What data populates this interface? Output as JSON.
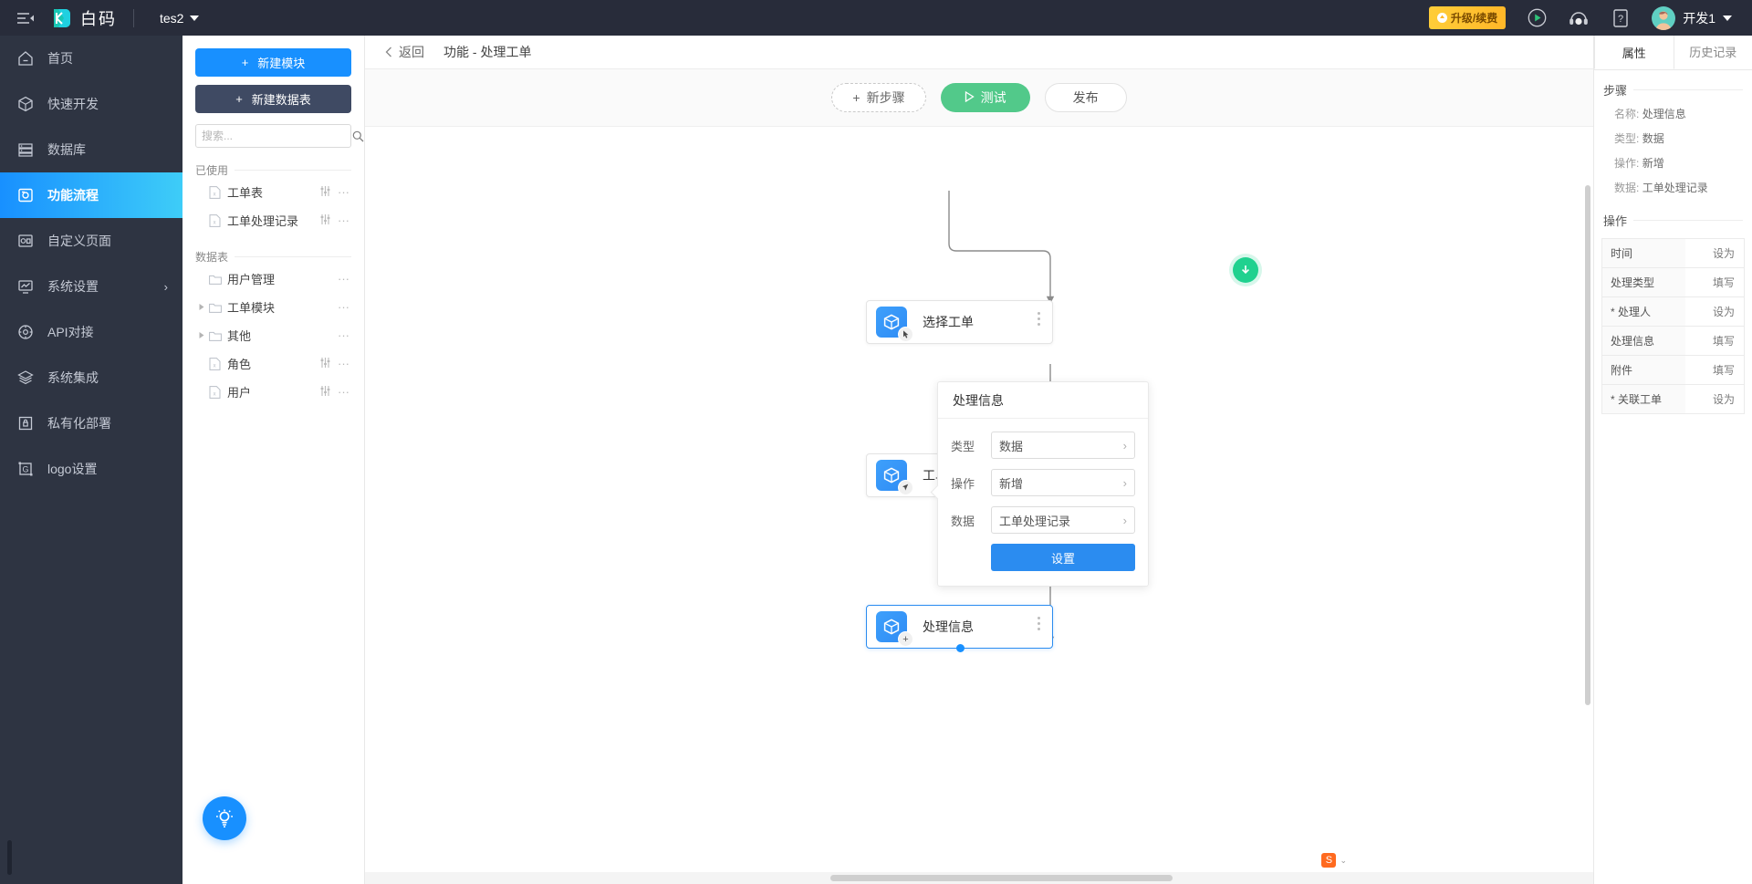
{
  "topbar": {
    "hamburger_icon": "menu-collapse-icon",
    "logo_text": "白码",
    "project_name": "tes2",
    "upgrade_label": "升级/续费",
    "icons": [
      "play-circle-icon",
      "headset-support-icon",
      "help-question-icon"
    ],
    "user_name": "开发1"
  },
  "leftnav": {
    "items": [
      {
        "label": "首页",
        "icon": "home-icon",
        "active": false,
        "arrow": ""
      },
      {
        "label": "快速开发",
        "icon": "cube-icon",
        "active": false,
        "arrow": ""
      },
      {
        "label": "数据库",
        "icon": "database-icon",
        "active": false,
        "arrow": ""
      },
      {
        "label": "功能流程",
        "icon": "flow-icon",
        "active": true,
        "arrow": ""
      },
      {
        "label": "自定义页面",
        "icon": "dashboard-icon",
        "active": false,
        "arrow": ""
      },
      {
        "label": "系统设置",
        "icon": "monitor-chart-icon",
        "active": false,
        "arrow": "›"
      },
      {
        "label": "API对接",
        "icon": "api-icon",
        "active": false,
        "arrow": ""
      },
      {
        "label": "系统集成",
        "icon": "layers-icon",
        "active": false,
        "arrow": ""
      },
      {
        "label": "私有化部署",
        "icon": "lock-server-icon",
        "active": false,
        "arrow": ""
      },
      {
        "label": "logo设置",
        "icon": "logo-frame-icon",
        "active": false,
        "arrow": ""
      }
    ]
  },
  "modpanel": {
    "new_module_label": "新建模块",
    "new_table_label": "新建数据表",
    "search_placeholder": "搜索...",
    "search_value": "",
    "group_used": "已使用",
    "group_tables": "数据表",
    "used_items": [
      {
        "label": "工单表",
        "icon": "file-sheet-icon",
        "has_twisty": false,
        "has_settings": true
      },
      {
        "label": "工单处理记录",
        "icon": "file-sheet-icon",
        "has_twisty": false,
        "has_settings": true
      }
    ],
    "table_items": [
      {
        "label": "用户管理",
        "icon": "folder-icon",
        "has_twisty": false,
        "has_settings": false
      },
      {
        "label": "工单模块",
        "icon": "folder-icon",
        "has_twisty": true,
        "has_settings": false
      },
      {
        "label": "其他",
        "icon": "folder-icon",
        "has_twisty": true,
        "has_settings": false
      },
      {
        "label": "角色",
        "icon": "file-sheet-icon",
        "has_twisty": false,
        "has_settings": true
      },
      {
        "label": "用户",
        "icon": "file-sheet-icon",
        "has_twisty": false,
        "has_settings": true
      }
    ]
  },
  "breadcrumb": {
    "back_label": "返回",
    "title": "功能 - 处理工单"
  },
  "flowtoolbar": {
    "new_step_label": "新步骤",
    "test_label": "测试",
    "publish_label": "发布"
  },
  "flow": {
    "nodes": [
      {
        "label": "选择工单",
        "badge": "cursor-pointer-icon",
        "selected": false
      },
      {
        "label": "工单信息",
        "badge": "cursor-arrow-icon",
        "selected": false
      },
      {
        "label": "处理信息",
        "badge": "plus-icon",
        "selected": true
      }
    ]
  },
  "popup": {
    "title": "处理信息",
    "rows": [
      {
        "label": "类型",
        "value": "数据"
      },
      {
        "label": "操作",
        "value": "新增"
      },
      {
        "label": "数据",
        "value": "工单处理记录"
      }
    ],
    "button_label": "设置"
  },
  "rightpanel": {
    "tabs": [
      {
        "label": "属性",
        "active": true
      },
      {
        "label": "历史记录",
        "active": false
      }
    ],
    "section_step": "步骤",
    "step_fields": [
      {
        "key": "名称:",
        "value": "处理信息"
      },
      {
        "key": "类型:",
        "value": "数据"
      },
      {
        "key": "操作:",
        "value": "新增"
      },
      {
        "key": "数据:",
        "value": "工单处理记录"
      }
    ],
    "section_ops": "操作",
    "op_rows": [
      {
        "name": "时间",
        "action": "设为"
      },
      {
        "name": "处理类型",
        "action": "填写"
      },
      {
        "name": "* 处理人",
        "action": "设为"
      },
      {
        "name": "处理信息",
        "action": "填写"
      },
      {
        "name": "附件",
        "action": "填写"
      },
      {
        "name": "* 关联工单",
        "action": "设为"
      }
    ]
  },
  "fab": {
    "icon": "lightbulb-icon"
  },
  "statusbar": {
    "ime_label": "S"
  },
  "colors": {
    "brand_blue": "#1890ff",
    "nav_dark": "#2e3442",
    "topbar_dark": "#282c3a",
    "test_green": "#52c98a",
    "upgrade_yellow": "#ffc22b"
  }
}
